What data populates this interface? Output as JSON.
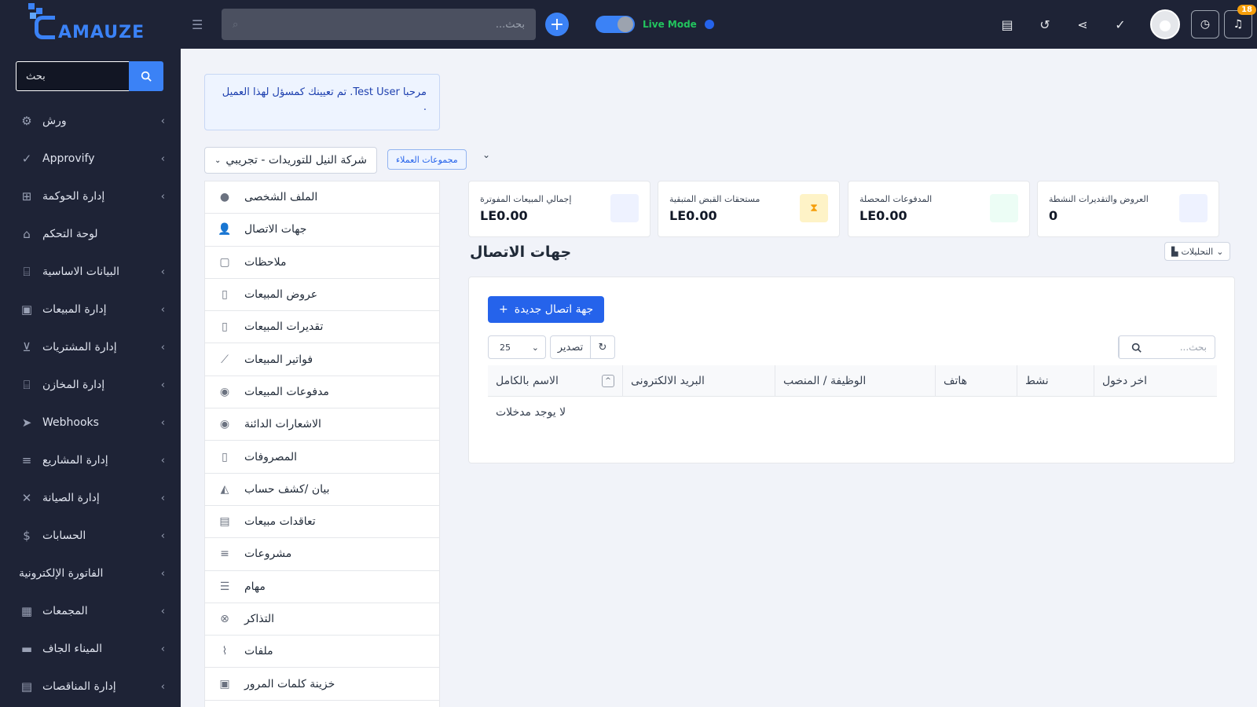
{
  "app": {
    "logo_text": "AMAUZE"
  },
  "sidebar": {
    "search_placeholder": "بحث",
    "items": [
      {
        "label": "ورش",
        "icon": "workshop-icon",
        "arrow": true
      },
      {
        "label": "Approvify",
        "icon": "check-icon",
        "arrow": true
      },
      {
        "label": "إدارة الحوكمة",
        "icon": "governance-icon",
        "arrow": true
      },
      {
        "label": "لوحة التحكم",
        "icon": "home-icon",
        "arrow": false
      },
      {
        "label": "البيانات الاساسية",
        "icon": "bank-icon",
        "arrow": true
      },
      {
        "label": "إدارة المبيعات",
        "icon": "sales-icon",
        "arrow": true
      },
      {
        "label": "إدارة المشتريات",
        "icon": "cart-icon",
        "arrow": true
      },
      {
        "label": "إدارة المخازن",
        "icon": "warehouse-icon",
        "arrow": true
      },
      {
        "label": "Webhooks",
        "icon": "send-icon",
        "arrow": true
      },
      {
        "label": "إدارة المشاريع",
        "icon": "projects-icon",
        "arrow": true
      },
      {
        "label": "إدارة الصيانة",
        "icon": "tools-icon",
        "arrow": true
      },
      {
        "label": "الحسابات",
        "icon": "dollar-icon",
        "arrow": true
      },
      {
        "label": "الفاتورة الإلكترونية",
        "icon": "",
        "arrow": true
      },
      {
        "label": "المجمعات",
        "icon": "building-icon",
        "arrow": true
      },
      {
        "label": "الميناء الجاف",
        "icon": "truck-icon",
        "arrow": true
      },
      {
        "label": "إدارة المناقصات",
        "icon": "document-icon",
        "arrow": true
      }
    ]
  },
  "topbar": {
    "search_placeholder": "بحث...",
    "live_mode_label": "Live Mode",
    "notification_count": "18"
  },
  "alert": {
    "text": "مرحبا Test User. تم تعيينك كمسؤل لهذا العميل ."
  },
  "client": {
    "selected": "شركة النيل للتوريدات - تجريبي",
    "group_label": "مجموعات العملاء"
  },
  "profile_tabs": [
    {
      "label": "الملف الشخصى",
      "icon": "user-circle-icon"
    },
    {
      "label": "جهات الاتصال",
      "icon": "contact-icon",
      "active": true
    },
    {
      "label": "ملاحظات",
      "icon": "note-icon"
    },
    {
      "label": "عروض المبيعات",
      "icon": "file-icon"
    },
    {
      "label": "تقديرات المبيعات",
      "icon": "file-icon"
    },
    {
      "label": "فواتير المبيعات",
      "icon": "chart-line-icon"
    },
    {
      "label": "مدفوعات المبيعات",
      "icon": "money-bag-icon"
    },
    {
      "label": "الاشعارات الدائنة",
      "icon": "money-bag-icon"
    },
    {
      "label": "المصروفات",
      "icon": "receipt-icon"
    },
    {
      "label": "بيان /كشف حساب",
      "icon": "area-chart-icon"
    },
    {
      "label": "تعاقدات مبيعات",
      "icon": "contract-icon"
    },
    {
      "label": "مشروعات",
      "icon": "gantt-icon"
    },
    {
      "label": "مهام",
      "icon": "tasks-icon"
    },
    {
      "label": "التذاكر",
      "icon": "lifebuoy-icon"
    },
    {
      "label": "ملفات",
      "icon": "paperclip-icon"
    },
    {
      "label": "خزينة كلمات المرور",
      "icon": "lock-icon"
    }
  ],
  "stats": [
    {
      "title": "إجمالي المبيعات المفوترة",
      "value": "LE0.00",
      "color": "#eef2ff"
    },
    {
      "title": "مستحقات القبض المتبقية",
      "value": "LE0.00",
      "color": "#fef3c7"
    },
    {
      "title": "المدفوعات المحصلة",
      "value": "LE0.00",
      "color": "#ecfdf5"
    },
    {
      "title": "العروض والتقديرات النشطة",
      "value": "0",
      "color": "#eef2ff"
    }
  ],
  "analytics_label": "التحليلات",
  "section_title": "جهات الاتصال",
  "contacts": {
    "new_button": "جهة اتصال جديدة",
    "page_size": "25",
    "export_label": "تصدير",
    "search_placeholder": "بحث...",
    "columns": [
      "الاسم بالكامل",
      "البريد الالكترونى",
      "الوظيفة / المنصب",
      "هاتف",
      "نشط",
      "اخر دخول"
    ],
    "empty_text": "لا يوجد مدخلات"
  },
  "colors": {
    "accent": "#2563eb",
    "sidebar_bg": "#1e2336",
    "live_green": "#22c55e",
    "badge": "#f59e0b"
  }
}
